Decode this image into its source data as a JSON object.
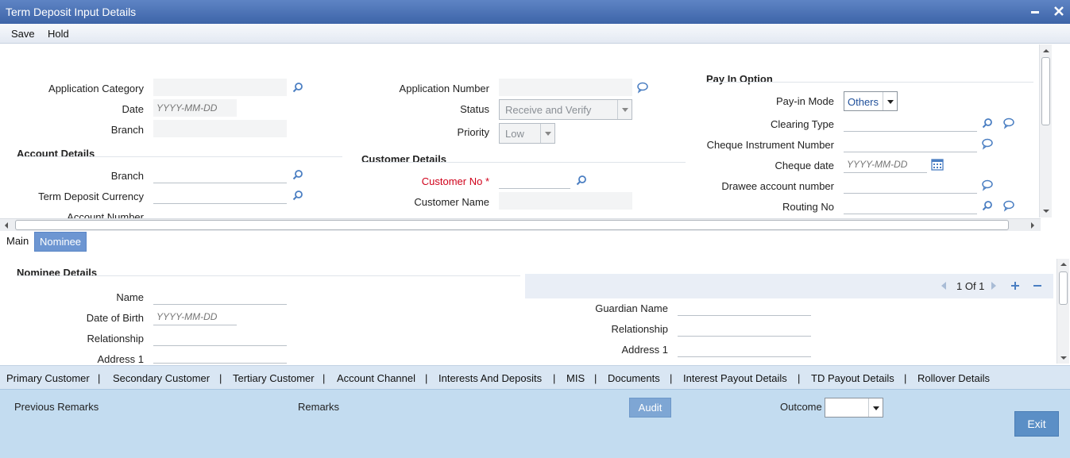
{
  "window": {
    "title": "Term Deposit Input Details",
    "minimize_icon": "minimize-icon",
    "close_icon": "close-icon"
  },
  "menu": {
    "save": "Save",
    "hold": "Hold"
  },
  "header": {
    "application_category_label": "Application Category",
    "date_label": "Date",
    "date_placeholder": "YYYY-MM-DD",
    "branch_label": "Branch",
    "application_number_label": "Application Number",
    "status_label": "Status",
    "status_value": "Receive and Verify",
    "priority_label": "Priority",
    "priority_value": "Low"
  },
  "account_details": {
    "title": "Account Details",
    "branch_label": "Branch",
    "currency_label": "Term Deposit Currency",
    "account_number_label": "Account Number"
  },
  "customer_details": {
    "title": "Customer Details",
    "customer_no_label": "Customer No",
    "required_mark": "*",
    "customer_name_label": "Customer Name"
  },
  "pay_in": {
    "title": "Pay In Option",
    "mode_label": "Pay-in Mode",
    "mode_value": "Others",
    "clearing_type_label": "Clearing Type",
    "cheque_instrument_label": "Cheque Instrument Number",
    "cheque_date_label": "Cheque date",
    "cheque_date_placeholder": "YYYY-MM-DD",
    "drawee_account_label": "Drawee account number",
    "routing_no_label": "Routing No"
  },
  "tabs": {
    "main": "Main",
    "nominee": "Nominee"
  },
  "nominee": {
    "title": "Nominee Details",
    "name_label": "Name",
    "dob_label": "Date of Birth",
    "dob_placeholder": "YYYY-MM-DD",
    "relationship_label": "Relationship",
    "address1_label": "Address 1",
    "guardian_name_label": "Guardian Name",
    "guardian_relationship_label": "Relationship",
    "guardian_address1_label": "Address 1",
    "pagination": "1 Of 1"
  },
  "links": [
    "Primary Customer",
    "|",
    "Secondary Customer",
    "|",
    "Tertiary Customer",
    "|",
    "Account Channel",
    "|",
    "Interests And Deposits",
    "|",
    "MIS",
    "|",
    "Documents",
    "|",
    "Interest Payout Details",
    "|",
    "TD Payout Details",
    "|",
    "Rollover Details"
  ],
  "footer": {
    "previous_remarks": "Previous Remarks",
    "remarks": "Remarks",
    "audit": "Audit",
    "outcome_label": "Outcome",
    "outcome_value": "",
    "exit": "Exit"
  },
  "colors": {
    "titlebar": "#4a72b6",
    "accent": "#5b8fc6",
    "footer": "#c3dcf0",
    "required": "#d0021b"
  }
}
